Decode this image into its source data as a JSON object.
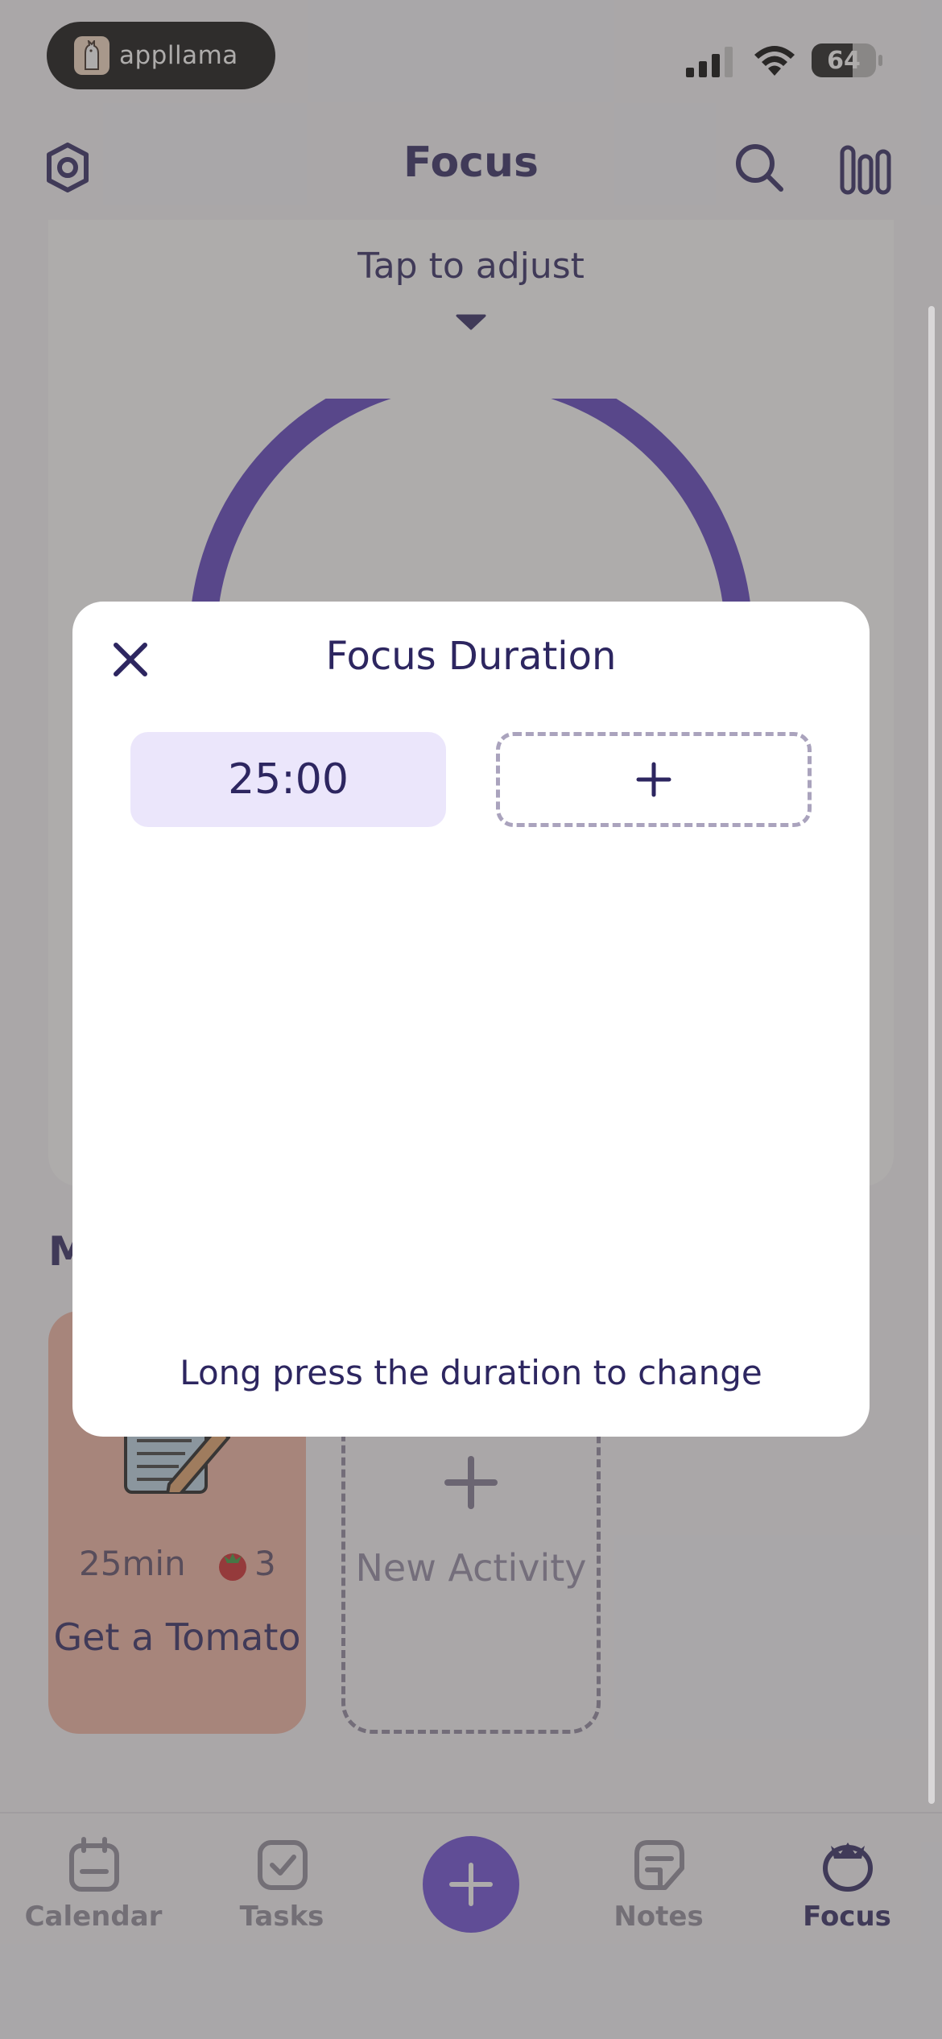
{
  "status_bar": {
    "app_name": "appllama",
    "battery_level": "64",
    "battery_fraction": 0.64
  },
  "header": {
    "title": "Focus"
  },
  "focus_card": {
    "tap_hint": "Tap to adjust",
    "accent_color": "#5a3fc0"
  },
  "activities": {
    "section_title": "M",
    "items": [
      {
        "duration": "25min",
        "count": "3",
        "name": "Get a Tomato",
        "color": "#f2b5a4"
      }
    ],
    "new_label": "New Activity"
  },
  "tab_bar": {
    "tabs": [
      {
        "label": "Calendar",
        "icon": "calendar-icon",
        "active": false
      },
      {
        "label": "Tasks",
        "icon": "check-square-icon",
        "active": false
      },
      {
        "label": "Notes",
        "icon": "sticky-note-icon",
        "active": false
      },
      {
        "label": "Focus",
        "icon": "tomato-icon",
        "active": true
      }
    ],
    "fab_icon": "plus-icon",
    "fab_color": "#6a4ad6"
  },
  "modal": {
    "title": "Focus Duration",
    "durations": [
      "25:00"
    ],
    "hint": "Long press the duration to change",
    "chip_color": "#ebe6fb"
  }
}
